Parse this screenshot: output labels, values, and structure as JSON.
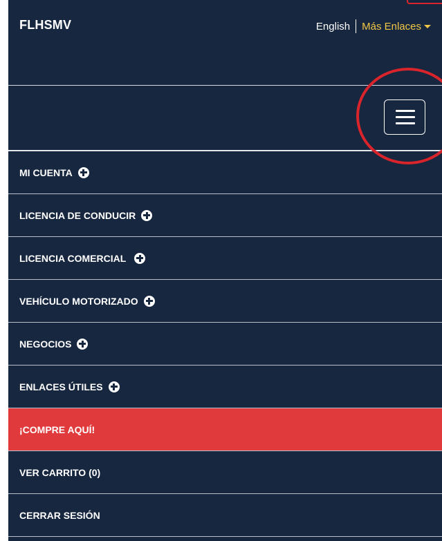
{
  "header": {
    "brand": "FLHSMV",
    "lang_english": "English",
    "more_links": "Más Enlaces"
  },
  "colors": {
    "nav_background": "#172740",
    "accent_yellow": "#f2c744",
    "buy_red": "#e03a3c",
    "annotation_red": "#d8242a"
  },
  "menu": {
    "items": [
      {
        "label": "MI CUENTA",
        "icon": "plus-circle-icon"
      },
      {
        "label": "LICENCIA DE CONDUCIR",
        "icon": "plus-circle-icon"
      },
      {
        "label": "LICENCIA COMERCIAL",
        "icon": "plus-circle-icon"
      },
      {
        "label": "VEHÍCULO MOTORIZADO",
        "icon": "plus-circle-icon"
      },
      {
        "label": "NEGOCIOS",
        "icon": "plus-circle-icon"
      },
      {
        "label": "ENLACES ÚTILES",
        "icon": "plus-circle-icon"
      },
      {
        "label": "¡COMPRE AQUÍ!"
      },
      {
        "label": "VER CARRITO (0)"
      },
      {
        "label": "CERRAR SESIÓN"
      }
    ]
  }
}
